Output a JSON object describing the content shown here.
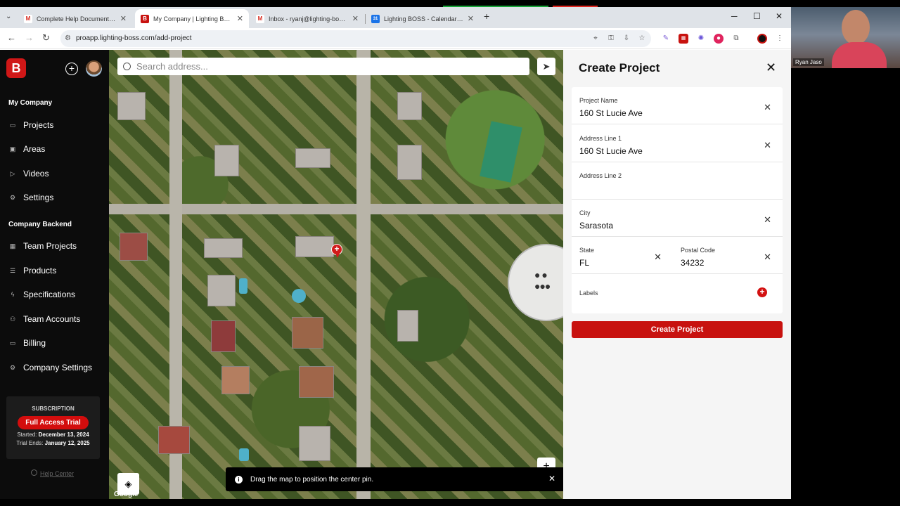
{
  "browser": {
    "tabs": [
      {
        "title": "Complete Help Documentation",
        "favicon": "gmail-icon",
        "color": "#d93025",
        "fav_text": "M"
      },
      {
        "title": "My Company | Lighting BOSS P",
        "favicon": "lighting-boss-icon",
        "color": "#c8120f",
        "fav_text": "B"
      },
      {
        "title": "Inbox - ryanj@lighting-boss.co",
        "favicon": "gmail-icon",
        "color": "#d93025",
        "fav_text": "M"
      },
      {
        "title": "Lighting BOSS - Calendar - We",
        "favicon": "calendar-icon",
        "color": "#1a73e8",
        "fav_text": "31"
      }
    ],
    "url": "proapp.lighting-boss.com/add-project"
  },
  "sidebar": {
    "logo_text": "B",
    "section_company": "My Company",
    "company_items": [
      {
        "label": "Projects",
        "icon": "folder-icon"
      },
      {
        "label": "Areas",
        "icon": "image-icon"
      },
      {
        "label": "Videos",
        "icon": "video-icon"
      },
      {
        "label": "Settings",
        "icon": "gear-icon"
      }
    ],
    "section_backend": "Company Backend",
    "backend_items": [
      {
        "label": "Team Projects",
        "icon": "grid-icon"
      },
      {
        "label": "Products",
        "icon": "list-icon"
      },
      {
        "label": "Specifications",
        "icon": "bolt-icon"
      },
      {
        "label": "Team Accounts",
        "icon": "users-icon"
      },
      {
        "label": "Billing",
        "icon": "card-icon"
      },
      {
        "label": "Company Settings",
        "icon": "gear-icon"
      }
    ],
    "subscription": {
      "heading": "SUBSCRIPTION",
      "plan": "Full Access Trial",
      "started_label": "Started:",
      "started_value": "December 13, 2024",
      "ends_label": "Trial Ends:",
      "ends_value": "January 12, 2025"
    },
    "help_center": "Help Center"
  },
  "map": {
    "search_placeholder": "Search address...",
    "toast": "Drag the map to position the center pin.",
    "google_mark": "Google"
  },
  "panel": {
    "title": "Create Project",
    "fields": {
      "project_name": {
        "label": "Project Name",
        "value": "160 St Lucie Ave"
      },
      "address1": {
        "label": "Address Line 1",
        "value": "160 St Lucie Ave"
      },
      "address2": {
        "label": "Address Line 2",
        "value": ""
      },
      "city": {
        "label": "City",
        "value": "Sarasota"
      },
      "state": {
        "label": "State",
        "value": "FL"
      },
      "postal": {
        "label": "Postal Code",
        "value": "34232"
      },
      "labels": {
        "label": "Labels"
      }
    },
    "submit": "Create Project"
  },
  "video": {
    "name": "Ryan Jaso"
  },
  "colors": {
    "brand": "#c8120f",
    "sidebar": "#0c0c0c"
  }
}
